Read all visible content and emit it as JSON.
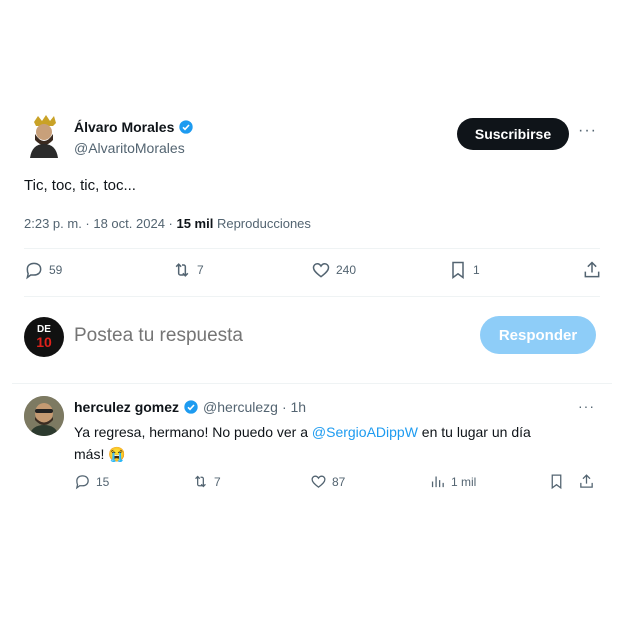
{
  "tweet": {
    "author_name": "Álvaro Morales",
    "author_handle": "@AlvaritoMorales",
    "subscribe_label": "Suscribirse",
    "more_label": "···",
    "text": "Tic, toc, tic, toc...",
    "timestamp": "2:23 p. m. · 18 oct. 2024 · ",
    "views_count": "15 mil",
    "views_label": " Reproducciones",
    "replies": "59",
    "retweets": "7",
    "likes": "240",
    "bookmarks": "1"
  },
  "composer": {
    "avatar_top": "DE",
    "avatar_num": "10",
    "placeholder": "Postea tu respuesta",
    "respond_label": "Responder"
  },
  "reply": {
    "author_name": "herculez gomez",
    "author_handle": "@herculezg",
    "time": "· 1h",
    "more_label": "···",
    "text_before": "Ya regresa, hermano! No puedo ver a ",
    "mention": "@SergioADippW",
    "text_after": " en tu lugar un día más! 😭",
    "replies": "15",
    "retweets": "7",
    "likes": "87",
    "views": "1 mil"
  },
  "colors": {
    "accent": "#1d9bf0",
    "text": "#0f1419",
    "muted": "#536471",
    "respond_disabled": "#8ecdf8"
  },
  "icons": [
    "verified-badge-icon",
    "reply-icon",
    "retweet-icon",
    "like-icon",
    "bookmark-icon",
    "share-icon",
    "views-icon",
    "more-icon"
  ]
}
